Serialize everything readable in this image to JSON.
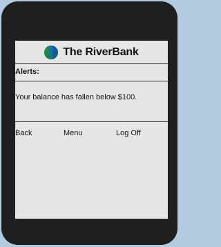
{
  "brand": {
    "name": "The RiverBank",
    "logo_icon": "riverbank-logo-icon",
    "logo_colors": [
      "#1a8a4a",
      "#1d6fb3"
    ]
  },
  "alerts": {
    "label": "Alerts:",
    "message": "Your balance has fallen below $100."
  },
  "nav": {
    "back_label": "Back",
    "menu_label": "Menu",
    "logoff_label": "Log Off"
  }
}
